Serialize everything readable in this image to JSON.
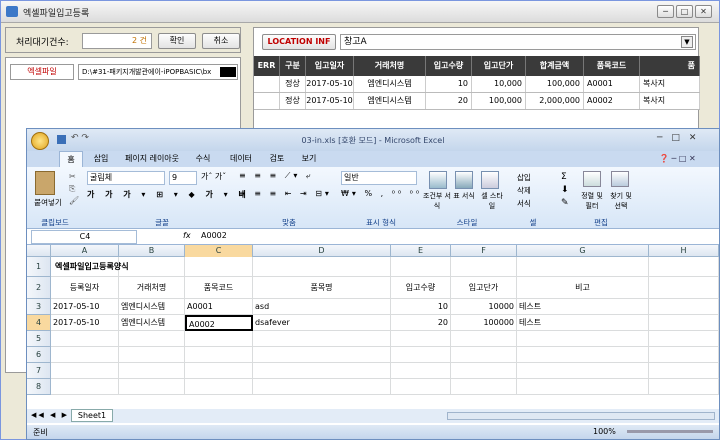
{
  "app": {
    "title": "엑셀파일입고등록",
    "controls": [
      "─",
      "□",
      "✕"
    ]
  },
  "left": {
    "count_label": "처리대기건수:",
    "count_value": "2 건",
    "confirm_label": "확인",
    "cancel_label": "취소",
    "file_label": "엑셀파일",
    "file_path": "D:\\#31-패키지개발관에이-iPOPBASIC\\bx"
  },
  "location": {
    "label": "LOCATION INF",
    "value": "창고A"
  },
  "grid": {
    "headers": [
      "ERR",
      "구분",
      "입고일자",
      "거래처명",
      "입고수량",
      "입고단가",
      "합계금액",
      "품목코드",
      "품"
    ],
    "rows": [
      [
        "",
        "정상",
        "2017-05-10",
        "엠엔디시스템",
        "10",
        "10,000",
        "100,000",
        "A0001",
        "복사지"
      ],
      [
        "",
        "정상",
        "2017-05-10",
        "엠엔디시스템",
        "20",
        "100,000",
        "2,000,000",
        "A0002",
        "복사지"
      ]
    ]
  },
  "excel": {
    "title": "03-in.xls  [호환 모드] - Microsoft Excel",
    "tabs": [
      "홈",
      "삽입",
      "페이지 레이아웃",
      "수식",
      "데이터",
      "검토",
      "보기"
    ],
    "ribbon": {
      "paste": "붙여넣기",
      "clipboard": "클립보드",
      "font_name": "굴림체",
      "font_size": "9",
      "font_group": "글꼴",
      "align_group": "맞춤",
      "number_format": "일반",
      "number_group": "표시 형식",
      "cond_format": "조건부 서식",
      "table_format": "표 서식",
      "cell_style": "셀 스타일",
      "style_group": "스타일",
      "insert": "삽입",
      "delete": "삭제",
      "format": "서식",
      "cell_group": "셀",
      "sort": "정렬 및 필터",
      "find": "찾기 및 선택",
      "edit_group": "편집"
    },
    "name_box": "C4",
    "formula": "A0002",
    "fx": "fx",
    "columns": [
      "A",
      "B",
      "C",
      "D",
      "E",
      "F",
      "G",
      "H"
    ],
    "rows": [
      "1",
      "2",
      "3",
      "4",
      "5",
      "6",
      "7",
      "8"
    ],
    "sheet_title": "엑셀파일입고등록양식",
    "headers": [
      "등록일자",
      "거래처명",
      "품목코드",
      "품목명",
      "입고수량",
      "입고단가",
      "비고"
    ],
    "data": [
      [
        "2017-05-10",
        "엠엔디시스템",
        "A0001",
        "asd",
        "10",
        "10000",
        "테스트"
      ],
      [
        "2017-05-10",
        "엠엔디시스템",
        "A0002",
        "dsafever",
        "20",
        "100000",
        "테스트"
      ]
    ],
    "sheet_tab": "Sheet1",
    "status": "준비",
    "zoom": "100%"
  }
}
